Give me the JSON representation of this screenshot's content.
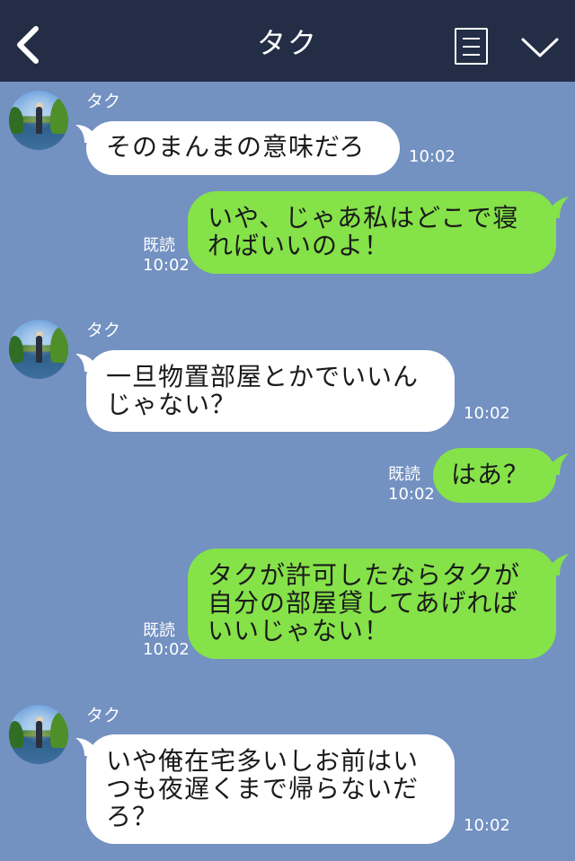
{
  "header": {
    "title": "タク",
    "back_icon": "chevron-left-icon",
    "menu_icon": "document-list-icon",
    "collapse_icon": "chevron-down-icon"
  },
  "colors": {
    "header_bg": "#232e46",
    "chat_bg": "#7391c1",
    "outgoing_bubble": "#85e249",
    "incoming_bubble": "#ffffff"
  },
  "messages": [
    {
      "sender": "タク",
      "lines": [
        "そのまんまの意味だろ"
      ],
      "time": "10:02"
    },
    {
      "lines": [
        "いや、じゃあ私はどこで寝",
        "ればいいのよ！"
      ],
      "read": "既読",
      "time": "10:02"
    },
    {
      "sender": "タク",
      "lines": [
        "一旦物置部屋とかでいいん",
        "じゃない？"
      ],
      "time": "10:02"
    },
    {
      "lines": [
        "はあ？"
      ],
      "read": "既読",
      "time": "10:02"
    },
    {
      "lines": [
        "タクが許可したならタクが",
        "自分の部屋貸してあげれば",
        "いいじゃない！"
      ],
      "read": "既読",
      "time": "10:02"
    },
    {
      "sender": "タク",
      "lines": [
        "いや俺在宅多いしお前はい",
        "つも夜遅くまで帰らないだ",
        "ろ？"
      ],
      "time": "10:02"
    }
  ]
}
